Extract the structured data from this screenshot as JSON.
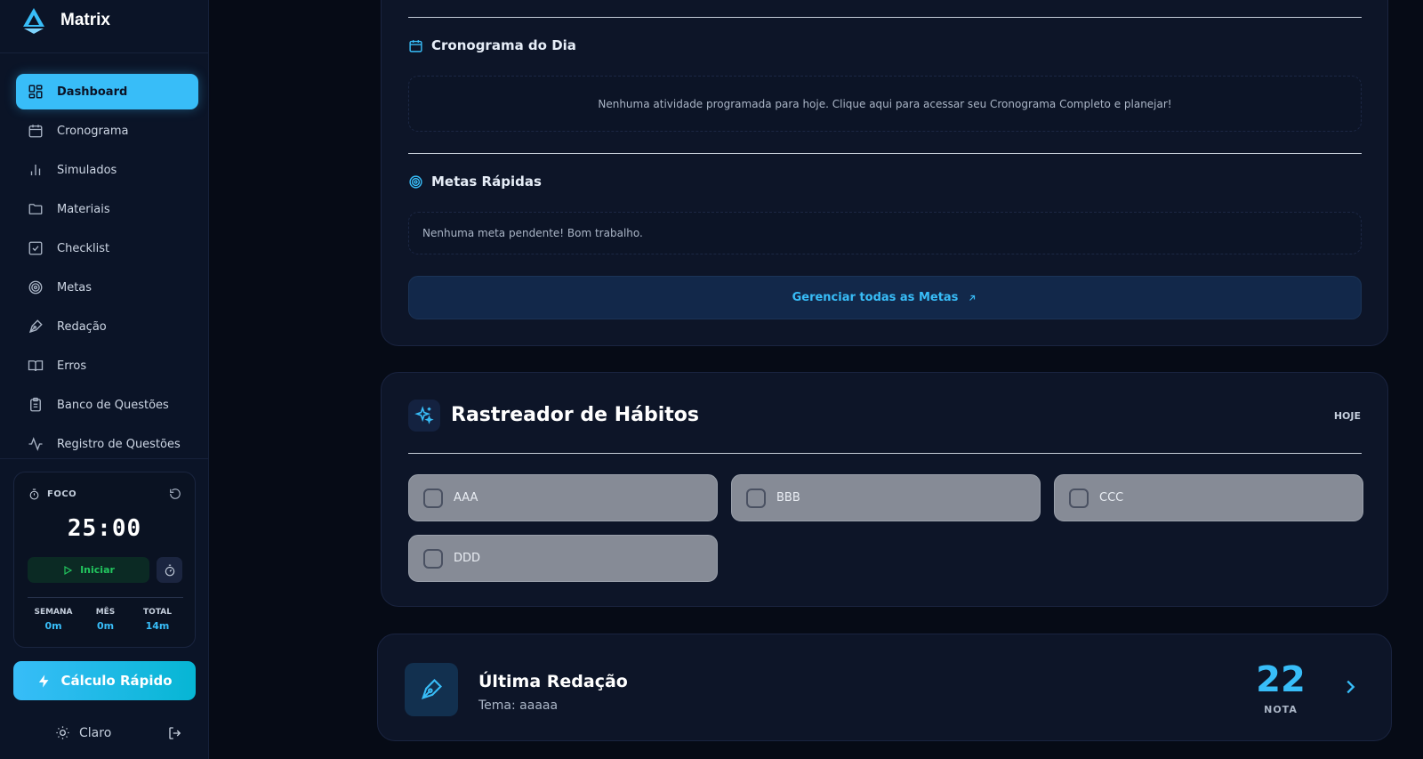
{
  "brand": {
    "title": "Matrix"
  },
  "sidebar": {
    "items": [
      {
        "label": "Dashboard",
        "icon": "dashboard-icon",
        "active": true
      },
      {
        "label": "Cronograma",
        "icon": "calendar-icon"
      },
      {
        "label": "Simulados",
        "icon": "bar-chart-icon"
      },
      {
        "label": "Materiais",
        "icon": "folder-icon"
      },
      {
        "label": "Checklist",
        "icon": "checkbox-icon"
      },
      {
        "label": "Metas",
        "icon": "target-icon"
      },
      {
        "label": "Redação",
        "icon": "pen-icon"
      },
      {
        "label": "Erros",
        "icon": "book-icon"
      },
      {
        "label": "Banco de Questões",
        "icon": "clipboard-icon"
      },
      {
        "label": "Registro de Questões",
        "icon": "activity-icon"
      }
    ]
  },
  "focus": {
    "label": "FOCO",
    "time": "25:00",
    "start_label": "Iniciar",
    "stats": [
      {
        "label": "SEMANA",
        "value": "0m"
      },
      {
        "label": "MÊS",
        "value": "0m"
      },
      {
        "label": "TOTAL",
        "value": "14m"
      }
    ]
  },
  "quick_calc": {
    "label": "Cálculo Rápido"
  },
  "theme": {
    "label": "Claro"
  },
  "schedule": {
    "title": "Cronograma do Dia",
    "empty": "Nenhuma atividade programada para hoje. Clique aqui para acessar seu Cronograma Completo e planejar!"
  },
  "goals": {
    "title": "Metas Rápidas",
    "empty": "Nenhuma meta pendente! Bom trabalho.",
    "manage_label": "Gerenciar todas as Metas"
  },
  "habits": {
    "title": "Rastreador de Hábitos",
    "today": "HOJE",
    "items": [
      "AAA",
      "BBB",
      "CCC",
      "DDD"
    ]
  },
  "essay": {
    "title": "Última Redação",
    "theme": "Tema: aaaaa",
    "score": "22",
    "score_label": "NOTA"
  },
  "colors": {
    "accent": "#38bdf8",
    "success": "#22c55e",
    "background": "#060b16",
    "card": "#0d1528"
  }
}
